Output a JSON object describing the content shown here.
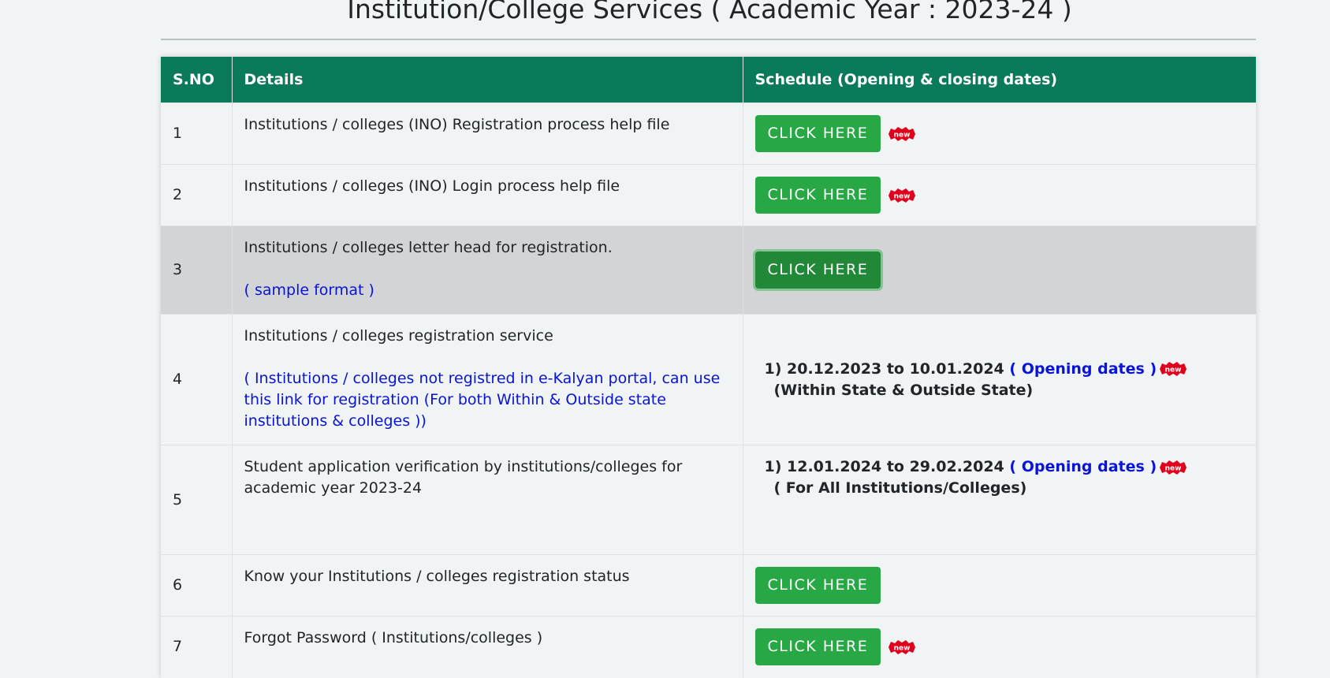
{
  "page": {
    "title": "Institution/College Services ( Academic Year : 2023-24 )"
  },
  "table": {
    "headers": {
      "sno": "S.NO",
      "details": "Details",
      "schedule": "Schedule (Opening & closing dates)"
    },
    "rows": [
      {
        "sno": "1",
        "details": "Institutions / colleges (INO) Registration process help file",
        "button": "CLICK HERE",
        "new_badge": "new"
      },
      {
        "sno": "2",
        "details": "Institutions / colleges (INO) Login process help file",
        "button": "CLICK HERE",
        "new_badge": "new"
      },
      {
        "sno": "3",
        "details": "Institutions / colleges letter head for registration.",
        "note": "( sample format )",
        "button": "CLICK HERE"
      },
      {
        "sno": "4",
        "details": "Institutions / colleges registration service",
        "note": "( Institutions / colleges not registred in e-Kalyan portal, can use this link for registration (For both Within & Outside state institutions & colleges ))",
        "schedule_dates": "1) 20.12.2023 to 10.01.2024",
        "schedule_label": "( Opening dates )",
        "schedule_sub": "(Within State & Outside State)",
        "new_badge": "new"
      },
      {
        "sno": "5",
        "details": "Student application verification by institutions/colleges for academic year 2023-24",
        "schedule_dates": "1) 12.01.2024 to 29.02.2024",
        "schedule_label": "( Opening dates )",
        "schedule_sub": "( For All Institutions/Colleges)",
        "new_badge": "new"
      },
      {
        "sno": "6",
        "details": "Know your Institutions / colleges registration status",
        "button": "CLICK HERE"
      },
      {
        "sno": "7",
        "details": "Forgot Password ( Institutions/colleges )",
        "button": "CLICK HERE",
        "new_badge": "new"
      }
    ]
  },
  "colors": {
    "header_bg": "#0a7a5a",
    "button_bg": "#28a745",
    "link_blue": "#0a14d6",
    "badge_red": "#e0001b"
  }
}
